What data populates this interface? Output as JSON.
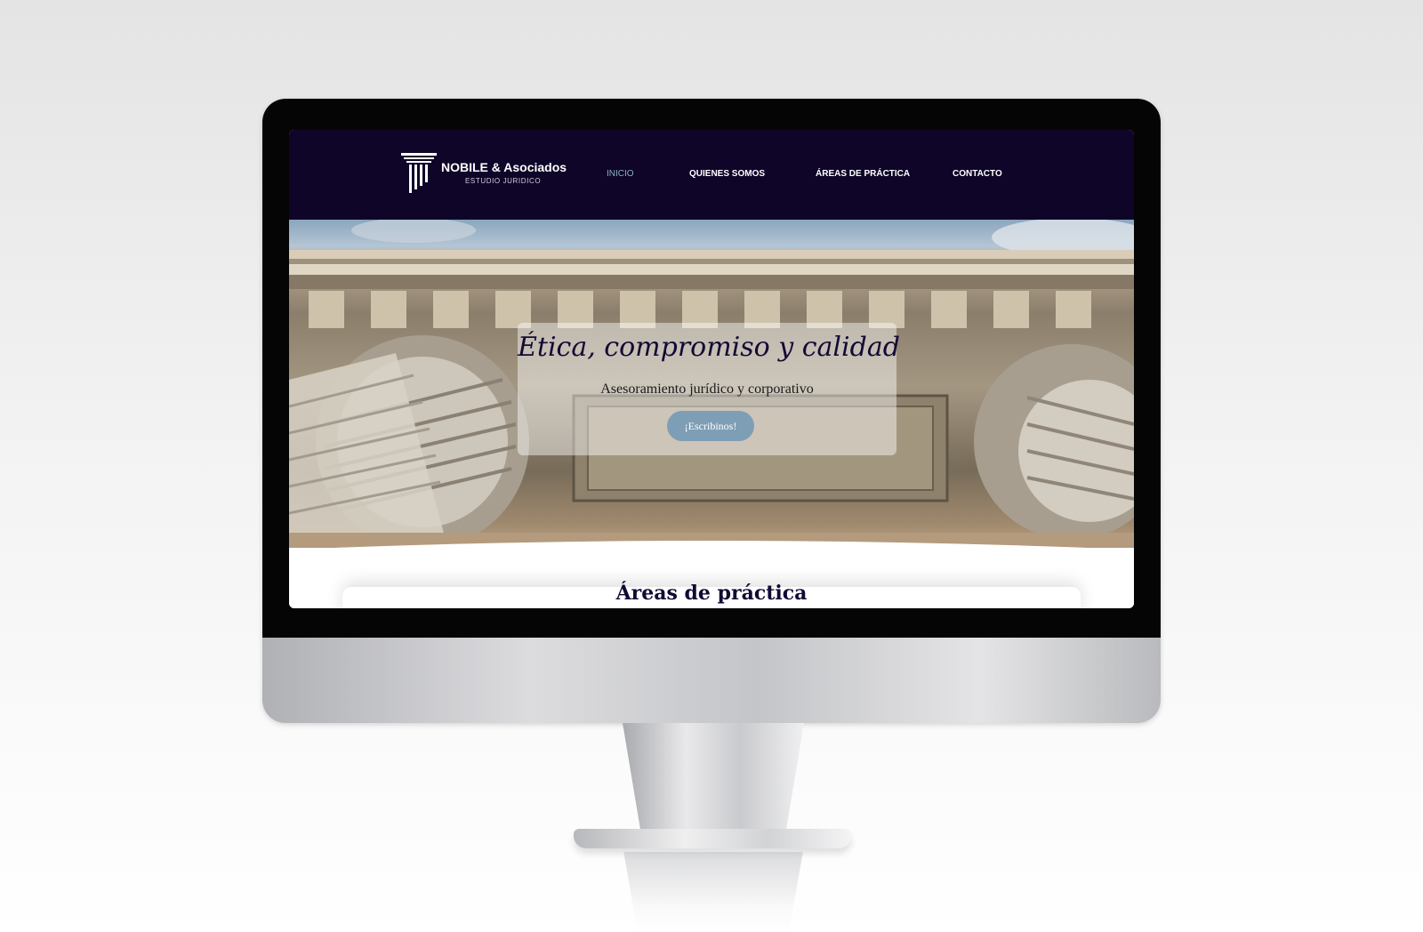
{
  "site": {
    "logo_title": "NOBILE & Asociados",
    "logo_subtitle": "ESTUDIO JURIDICO",
    "nav": [
      {
        "label": "INICIO",
        "active": true
      },
      {
        "label": "QUIENES SOMOS",
        "active": false
      },
      {
        "label": "ÁREAS DE PRÁCTICA",
        "active": false
      },
      {
        "label": "CONTACTO",
        "active": false
      }
    ]
  },
  "hero": {
    "title": "Ética, compromiso y calidad",
    "subtitle": "Asesoramiento jurídico y corporativo",
    "cta_label": "¡Escribinos!"
  },
  "section": {
    "heading": "Áreas de práctica"
  },
  "colors": {
    "header_bg": "#0e0528",
    "nav_active": "#8db0c8",
    "cta_bg": "#7e9eb5",
    "heading_text": "#120a33"
  }
}
